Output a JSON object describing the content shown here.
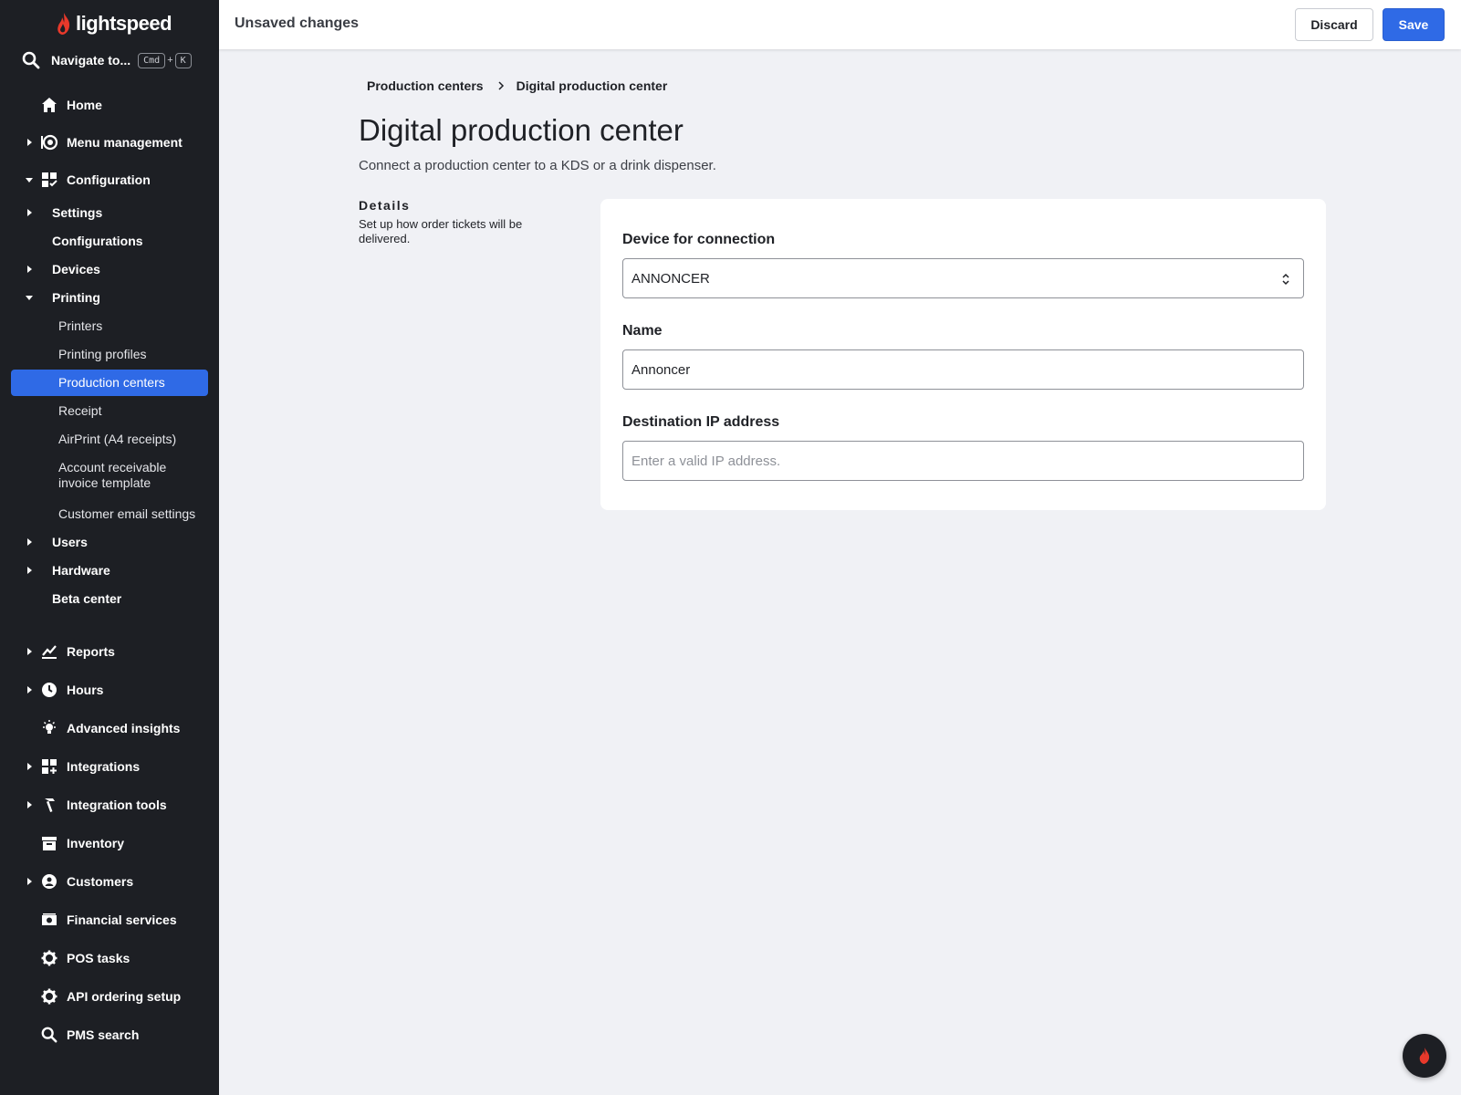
{
  "brand": {
    "name": "lightspeed",
    "accent": "#2f6ae6",
    "logo_color": "#e8392b"
  },
  "nav_search": {
    "label": "Navigate to...",
    "key1": "Cmd",
    "plus": "+",
    "key2": "K"
  },
  "sidebar": {
    "items": [
      {
        "label": "Home",
        "icon": "home-icon"
      },
      {
        "label": "Menu management",
        "icon": "menu-management-icon"
      },
      {
        "label": "Configuration",
        "icon": "configuration-icon"
      },
      {
        "label": "Settings"
      },
      {
        "label": "Configurations"
      },
      {
        "label": "Devices"
      },
      {
        "label": "Printing"
      },
      {
        "label": "Printers"
      },
      {
        "label": "Printing profiles"
      },
      {
        "label": "Production centers",
        "active": true
      },
      {
        "label": "Receipt"
      },
      {
        "label": "AirPrint (A4 receipts)"
      },
      {
        "label": "Account receivable",
        "label2": "invoice template"
      },
      {
        "label": "Customer email settings"
      },
      {
        "label": "Users"
      },
      {
        "label": "Hardware"
      },
      {
        "label": "Beta center"
      },
      {
        "label": "Reports",
        "icon": "reports-icon"
      },
      {
        "label": "Hours",
        "icon": "clock-icon"
      },
      {
        "label": "Advanced insights",
        "icon": "lightbulb-icon"
      },
      {
        "label": "Integrations",
        "icon": "integrations-icon"
      },
      {
        "label": "Integration tools",
        "icon": "hammer-icon"
      },
      {
        "label": "Inventory",
        "icon": "inventory-icon"
      },
      {
        "label": "Customers",
        "icon": "customer-icon"
      },
      {
        "label": "Financial services",
        "icon": "cash-icon"
      },
      {
        "label": "POS tasks",
        "icon": "gear-icon"
      },
      {
        "label": "API ordering setup",
        "icon": "gear-icon"
      },
      {
        "label": "PMS search",
        "icon": "search-icon"
      }
    ]
  },
  "topbar": {
    "title": "Unsaved changes",
    "discard_label": "Discard",
    "save_label": "Save"
  },
  "breadcrumb": {
    "parent": "Production centers",
    "current": "Digital production center"
  },
  "page": {
    "title": "Digital production center",
    "subtitle": "Connect a production center to a KDS or a drink dispenser.",
    "details_heading": "Details",
    "details_text": "Set up how order tickets will be delivered."
  },
  "form": {
    "device_label": "Device for connection",
    "device_value": "ANNONCER",
    "name_label": "Name",
    "name_value": "Annoncer",
    "ip_label": "Destination IP address",
    "ip_placeholder": "Enter a valid IP address."
  }
}
